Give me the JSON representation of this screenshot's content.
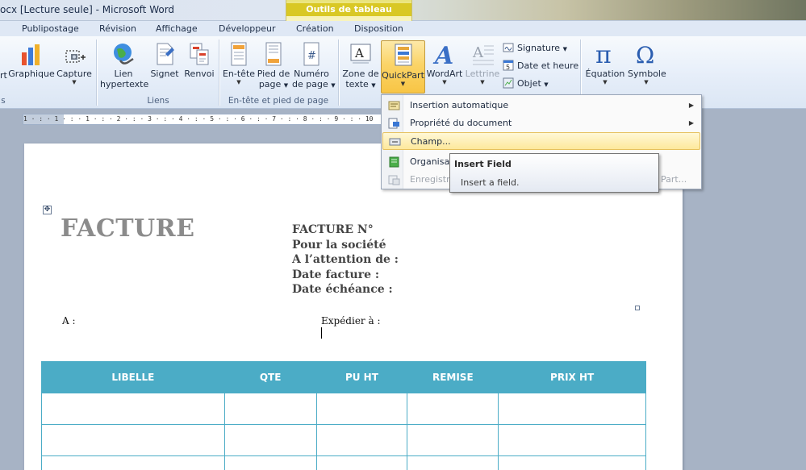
{
  "window": {
    "title": "ocx [Lecture seule]  -  Microsoft Word"
  },
  "context_tab": {
    "header": "Outils de tableau"
  },
  "tabs": [
    "Publipostage",
    "Révision",
    "Affichage",
    "Développeur",
    "Création",
    "Disposition"
  ],
  "ribbon": {
    "illustrations": {
      "partial": "rt",
      "graphique": "Graphique",
      "capture": "Capture",
      "group_partial": "s"
    },
    "liens": {
      "lien1": "Lien",
      "lien2": "hypertexte",
      "signet": "Signet",
      "renvoi": "Renvoi",
      "group": "Liens"
    },
    "entete": {
      "entete": "En-tête",
      "pied1": "Pied de",
      "pied2": "page",
      "num1": "Numéro",
      "num2": "de page",
      "group": "En-tête et pied de page"
    },
    "texte": {
      "zone1": "Zone de",
      "zone2": "texte",
      "quickpart": "QuickPart",
      "wordart": "WordArt",
      "lettrine": "Lettrine",
      "signature": "Signature",
      "date": "Date et heure",
      "objet": "Objet"
    },
    "symboles": {
      "equation": "Équation",
      "symbole": "Symbole"
    }
  },
  "ruler": {
    "text": "1 · : · 1 · : · 1 · : · 2 · : · 3 · : · 4 · : · 5 · : · 6 · : · 7 · : · 8 · : · 9 · : · 10"
  },
  "document": {
    "title": "FACTURE",
    "info": [
      "FACTURE N°",
      "Pour la société",
      "A l’attention  de :",
      "Date facture :",
      "Date échéance :"
    ],
    "to": "A :",
    "ship": "Expédier à :",
    "table_headers": [
      "LIBELLE",
      "QTE",
      "PU HT",
      "REMISE",
      "PRIX HT"
    ]
  },
  "menu": {
    "items": [
      {
        "label": "Insertion automatique"
      },
      {
        "label": "Propriété du document"
      },
      {
        "label": "Champ..."
      },
      {
        "label": "Organisat"
      },
      {
        "label": "Enregistr",
        "trail": "Part..."
      }
    ]
  },
  "tooltip": {
    "title": "Insert Field",
    "body": "Insert a field."
  }
}
